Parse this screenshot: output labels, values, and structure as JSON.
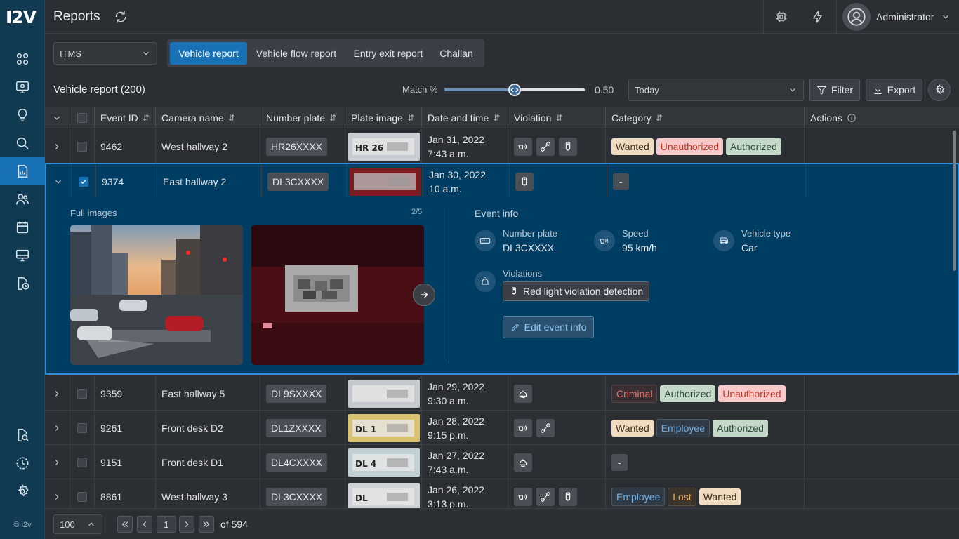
{
  "brand": {
    "logo": "I2V",
    "copyright": "© i2v"
  },
  "header": {
    "title": "Reports",
    "user": "Administrator"
  },
  "sidebar": {
    "items": [
      "dashboard",
      "monitor",
      "ideas",
      "search",
      "reports",
      "users",
      "calendar",
      "devices",
      "scheduled"
    ],
    "bottom": [
      "search-reports",
      "history",
      "settings"
    ]
  },
  "toolbar": {
    "system_select": "ITMS",
    "tabs": [
      {
        "label": "Vehicle report",
        "active": true
      },
      {
        "label": "Vehicle flow report"
      },
      {
        "label": "Entry exit report"
      },
      {
        "label": "Challan"
      }
    ]
  },
  "report": {
    "title": "Vehicle report (200)",
    "match_label": "Match %",
    "match_value": "0.50",
    "match_fraction": 0.5,
    "date_select": "Today",
    "filter_label": "Filter",
    "export_label": "Export"
  },
  "columns": [
    "Event ID",
    "Camera name",
    "Number plate",
    "Plate image",
    "Date and time",
    "Violation",
    "Category",
    "Actions"
  ],
  "rows": [
    {
      "id": "9462",
      "camera": "West hallway 2",
      "plate": "HR26XXXX",
      "date": "Jan 31, 2022",
      "time": "7:43 a.m.",
      "violations": [
        "speed",
        "seatbelt",
        "signal"
      ],
      "tags": [
        {
          "t": "Wanted",
          "k": "wanted"
        },
        {
          "t": "Unauthorized",
          "k": "unauth"
        },
        {
          "t": "Authorized",
          "k": "auth"
        }
      ],
      "plate_text": "HR 26"
    },
    {
      "id": "9374",
      "camera": "East hallway 2",
      "plate": "DL3CXXXX",
      "date": "Jan 30, 2022",
      "time": "10 a.m.",
      "violations": [
        "signal"
      ],
      "tags": [
        {
          "t": "-",
          "k": "dash"
        }
      ],
      "selected": true
    },
    {
      "id": "9359",
      "camera": "East hallway 5",
      "plate": "DL9SXXXX",
      "date": "Jan 29, 2022",
      "time": "9:30 a.m.",
      "violations": [
        "helmet"
      ],
      "tags": [
        {
          "t": "Criminal",
          "k": "criminal"
        },
        {
          "t": "Authorized",
          "k": "auth"
        },
        {
          "t": "Unauthorized",
          "k": "unauth"
        }
      ]
    },
    {
      "id": "9261",
      "camera": "Front desk D2",
      "plate": "DL1ZXXXX",
      "date": "Jan 28, 2022",
      "time": "9:15 p.m.",
      "violations": [
        "speed",
        "seatbelt"
      ],
      "tags": [
        {
          "t": "Wanted",
          "k": "wanted"
        },
        {
          "t": "Employee",
          "k": "employee"
        },
        {
          "t": "Authorized",
          "k": "auth"
        }
      ],
      "plate_text": "DL 1"
    },
    {
      "id": "9151",
      "camera": "Front desk D1",
      "plate": "DL4CXXXX",
      "date": "Jan 27, 2022",
      "time": "7:43 a.m.",
      "violations": [
        "helmet"
      ],
      "tags": [
        {
          "t": "-",
          "k": "dash"
        }
      ],
      "plate_text": "DL 4"
    },
    {
      "id": "8861",
      "camera": "West hallway 3",
      "plate": "DL3CXXXX",
      "date": "Jan 26, 2022",
      "time": "3:13 p.m.",
      "violations": [
        "speed",
        "seatbelt",
        "signal"
      ],
      "tags": [
        {
          "t": "Employee",
          "k": "employee"
        },
        {
          "t": "Lost",
          "k": "lost"
        },
        {
          "t": "Wanted",
          "k": "wanted"
        }
      ],
      "plate_text": "DL"
    }
  ],
  "expanded": {
    "full_images_label": "Full images",
    "counter": "2/5",
    "event_info_label": "Event info",
    "number_plate_label": "Number plate",
    "number_plate": "DL3CXXXX",
    "speed_label": "Speed",
    "speed": "95 km/h",
    "vehicle_type_label": "Vehicle type",
    "vehicle_type": "Car",
    "violations_label": "Violations",
    "violation_chip": "Red light violation detection",
    "edit_label": "Edit event info"
  },
  "footer": {
    "page_size": "100",
    "page": "1",
    "total": "of 594"
  }
}
